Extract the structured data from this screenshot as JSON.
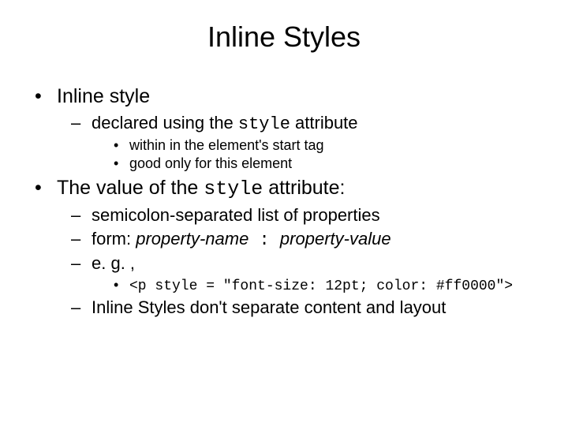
{
  "title": "Inline Styles",
  "b1": {
    "text": "Inline style",
    "sub1": {
      "t1": "declared using the ",
      "code": "style",
      "t2": " attribute",
      "d1": "within in the element's start tag",
      "d2": "good only for this element"
    }
  },
  "b2": {
    "t1": "The value of the ",
    "code": "style",
    "t2": " attribute:",
    "s1": "semicolon-separated list of properties",
    "s2": {
      "t1": "form: ",
      "pn": "property-name",
      "colon": " : ",
      "pv": "property-value"
    },
    "s3": {
      "t1": "e. g. ,",
      "code": "<p style = \"font-size: 12pt; color: #ff0000\">"
    },
    "s4": "Inline Styles don't separate content and layout"
  }
}
